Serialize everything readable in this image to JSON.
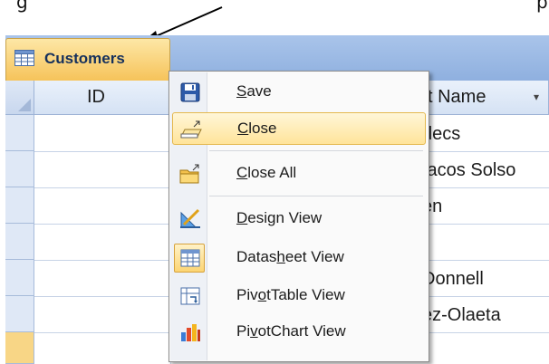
{
  "caption": {
    "left_text": "g",
    "right_text": "p"
  },
  "tab": {
    "label": "Customers",
    "icon": "table-icon"
  },
  "columns": [
    {
      "label": "ID"
    },
    {
      "label": "st Name",
      "sort_icon": "▾"
    }
  ],
  "rows": [
    "decs",
    "taccos Solso",
    "en",
    "",
    "Donnell",
    "ez-Olaeta",
    ""
  ],
  "rows_display": [
    "decs",
    "tacos Solso",
    "en",
    "",
    "Donnell",
    "ez-Olaeta",
    ""
  ],
  "context_menu": {
    "items": [
      {
        "label": "Save",
        "hotkey": "S",
        "icon": "floppy-disk-icon"
      },
      {
        "label": "Close",
        "hotkey": "C",
        "icon": "close-window-icon",
        "highlighted": true
      },
      {
        "label": "Close All",
        "hotkey": "C",
        "icon": "close-all-icon"
      },
      {
        "label": "Design View",
        "hotkey": "D",
        "icon": "design-view-icon"
      },
      {
        "label": "Datasheet View",
        "hotkey": "h",
        "icon": "datasheet-view-icon"
      },
      {
        "label": "PivotTable View",
        "hotkey": "o",
        "icon": "pivottable-view-icon"
      },
      {
        "label": "PivotChart View",
        "hotkey": "v",
        "icon": "pivotchart-view-icon"
      }
    ]
  },
  "colors": {
    "tab_bar": "#a9c4ea",
    "tab_active": "#f6c35a",
    "menu_highlight": "#ffe49a"
  }
}
